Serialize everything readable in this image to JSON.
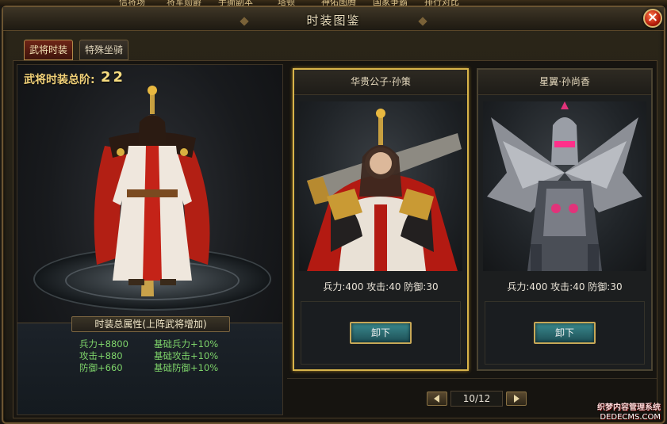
{
  "top_menu": [
    "信将场",
    "将军勋爵",
    "手撕副本",
    "塔顿",
    "神佑图腾",
    "国家争霸",
    "排行对比"
  ],
  "window": {
    "title": "时装图鉴",
    "close_icon": "close-icon"
  },
  "tabs": [
    {
      "label": "武将时装",
      "active": true
    },
    {
      "label": "特殊坐骑",
      "active": false
    }
  ],
  "left_panel": {
    "total_label": "武将时装总阶:",
    "total_value": "22",
    "attr_title": "时装总属性(上阵武将增加)",
    "attrs": [
      {
        "base": "兵力+8800",
        "bonus": "基础兵力+10%"
      },
      {
        "base": "攻击+880",
        "bonus": "基础攻击+10%"
      },
      {
        "base": "防御+660",
        "bonus": "基础防御+10%"
      }
    ]
  },
  "cards": [
    {
      "name": "华贵公子·孙策",
      "stats": "兵力:400 攻击:40 防御:30",
      "button": "卸下",
      "selected": true
    },
    {
      "name": "星翼·孙尚香",
      "stats": "兵力:400 攻击:40 防御:30",
      "button": "卸下",
      "selected": false
    }
  ],
  "pager": {
    "text": "10/12",
    "prev_icon": "arrow-left-icon",
    "next_icon": "arrow-right-icon"
  },
  "watermark": {
    "line1": "织梦内容管理系统",
    "line2": "DEDECMS.COM"
  },
  "colors": {
    "gold": "#f0d078",
    "attr_green": "#7ed46a",
    "frame": "#6b5532"
  }
}
